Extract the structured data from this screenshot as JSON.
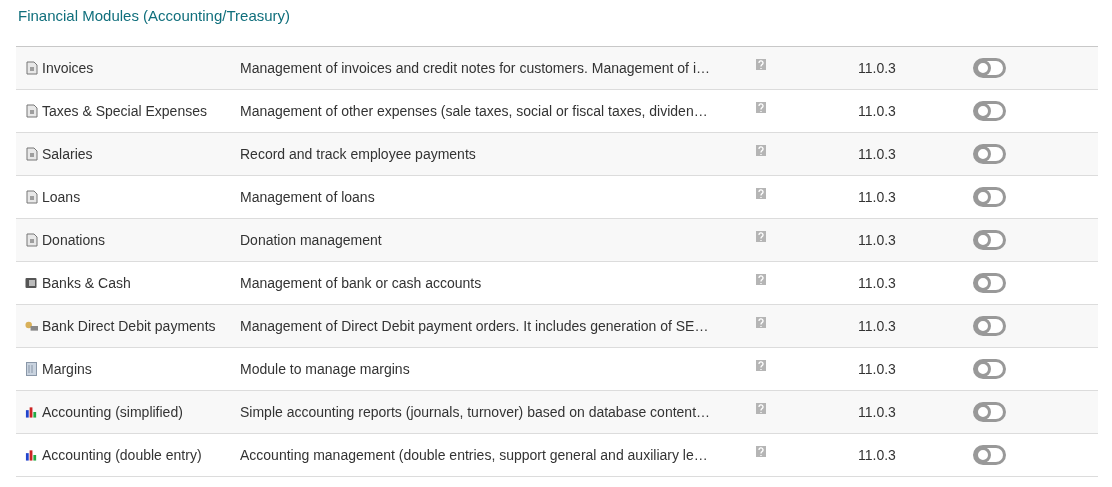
{
  "section_title": "Financial Modules (Accounting/Treasury)",
  "modules": [
    {
      "kind": "invoice",
      "name": "Invoices",
      "description": "Management of invoices and credit notes for customers. Management of i…",
      "version": "11.0.3",
      "on": false
    },
    {
      "kind": "invoice",
      "name": "Taxes & Special Expenses",
      "description": "Management of other expenses (sale taxes, social or fiscal taxes, dividen…",
      "version": "11.0.3",
      "on": false
    },
    {
      "kind": "invoice",
      "name": "Salaries",
      "description": "Record and track employee payments",
      "version": "11.0.3",
      "on": false
    },
    {
      "kind": "invoice",
      "name": "Loans",
      "description": "Management of loans",
      "version": "11.0.3",
      "on": false
    },
    {
      "kind": "invoice",
      "name": "Donations",
      "description": "Donation management",
      "version": "11.0.3",
      "on": false
    },
    {
      "kind": "safe",
      "name": "Banks & Cash",
      "description": "Management of bank or cash accounts",
      "version": "11.0.3",
      "on": false
    },
    {
      "kind": "debit",
      "name": "Bank Direct Debit payments",
      "description": "Management of Direct Debit payment orders. It includes generation of SE…",
      "version": "11.0.3",
      "on": false
    },
    {
      "kind": "margins",
      "name": "Margins",
      "description": "Module to manage margins",
      "version": "11.0.3",
      "on": false
    },
    {
      "kind": "chart",
      "name": "Accounting (simplified)",
      "description": "Simple accounting reports (journals, turnover) based on database content…",
      "version": "11.0.3",
      "on": false
    },
    {
      "kind": "chart",
      "name": "Accounting (double entry)",
      "description": "Accounting management (double entries, support general and auxiliary le…",
      "version": "11.0.3",
      "on": false
    }
  ]
}
